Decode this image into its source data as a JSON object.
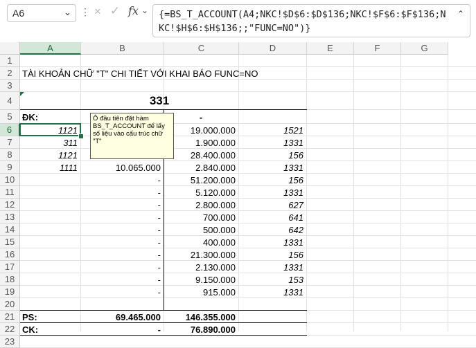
{
  "formula_bar": {
    "name_box": "A6",
    "formula": "{=BS_T_ACCOUNT(A4;NKC!$D$6:$D$136;NKC!$F$6:$F$136;NKC!$H$6:$H$136;;\"FUNC=NO\")}"
  },
  "columns": [
    "A",
    "B",
    "C",
    "D",
    "E",
    "F",
    "G"
  ],
  "rows": [
    "1",
    "2",
    "3",
    "4",
    "5",
    "6",
    "7",
    "8",
    "9",
    "10",
    "11",
    "12",
    "13",
    "14",
    "15",
    "16",
    "17",
    "18",
    "19",
    "20",
    "21",
    "22",
    "23"
  ],
  "sheet": {
    "title": "TÀI KHOẢN CHỮ \"T\" CHI TIẾT VỚI KHAI BÁO FUNC=NO",
    "account": "331",
    "opening_label": "ĐK:",
    "opening_credit": "-",
    "entries": [
      {
        "a": "1121",
        "b": "",
        "c": "19.000.000",
        "d": "1521"
      },
      {
        "a": "311",
        "b": "",
        "c": "1.900.000",
        "d": "1331"
      },
      {
        "a": "1121",
        "b": "",
        "c": "28.400.000",
        "d": "156"
      },
      {
        "a": "1111",
        "b": "10.065.000",
        "c": "2.840.000",
        "d": "1331"
      },
      {
        "a": "",
        "b": "-",
        "c": "51.200.000",
        "d": "156"
      },
      {
        "a": "",
        "b": "-",
        "c": "5.120.000",
        "d": "1331"
      },
      {
        "a": "",
        "b": "-",
        "c": "2.800.000",
        "d": "627"
      },
      {
        "a": "",
        "b": "-",
        "c": "700.000",
        "d": "641"
      },
      {
        "a": "",
        "b": "-",
        "c": "500.000",
        "d": "642"
      },
      {
        "a": "",
        "b": "-",
        "c": "400.000",
        "d": "1331"
      },
      {
        "a": "",
        "b": "-",
        "c": "21.300.000",
        "d": "156"
      },
      {
        "a": "",
        "b": "-",
        "c": "2.130.000",
        "d": "1331"
      },
      {
        "a": "",
        "b": "-",
        "c": "9.150.000",
        "d": "153"
      },
      {
        "a": "",
        "b": "-",
        "c": "915.000",
        "d": "1331"
      }
    ],
    "ps_label": "PS:",
    "ps_debit": "69.465.000",
    "ps_credit": "146.355.000",
    "ck_label": "CK:",
    "ck_debit": "-",
    "ck_credit": "76.890.000"
  },
  "comment": {
    "text": "Ô đầu tiên đặt hàm BS_T_ACCOUNT để lấy số liệu vào cấu trúc chữ \"T\""
  },
  "icons": {
    "cancel": "×",
    "enter": "✓",
    "fx": "fx",
    "dropdown": "⌄",
    "more": "⋮"
  }
}
